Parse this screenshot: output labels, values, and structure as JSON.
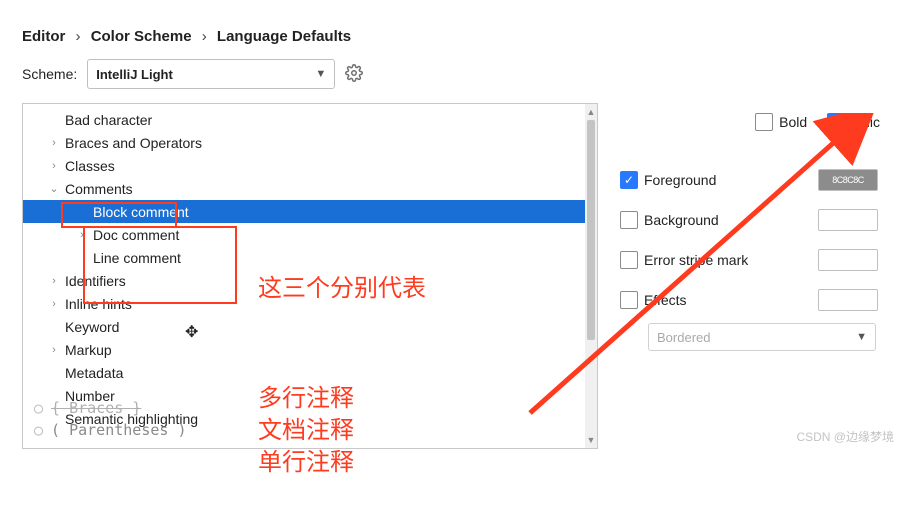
{
  "breadcrumb": [
    "Editor",
    "Color Scheme",
    "Language Defaults"
  ],
  "scheme": {
    "label": "Scheme:",
    "value": "IntelliJ Light"
  },
  "tree": [
    {
      "label": "Bad character",
      "exp": ""
    },
    {
      "label": "Braces and Operators",
      "exp": ">"
    },
    {
      "label": "Classes",
      "exp": ">"
    },
    {
      "label": "Comments",
      "exp": "v"
    },
    {
      "label": "Block comment",
      "exp": "",
      "child": true,
      "sel": true
    },
    {
      "label": "Doc comment",
      "exp": ">",
      "child": true
    },
    {
      "label": "Line comment",
      "exp": "",
      "child": true
    },
    {
      "label": "Identifiers",
      "exp": ">"
    },
    {
      "label": "Inline hints",
      "exp": ">"
    },
    {
      "label": "Keyword",
      "exp": ""
    },
    {
      "label": "Markup",
      "exp": ">"
    },
    {
      "label": "Metadata",
      "exp": ""
    },
    {
      "label": "Number",
      "exp": ""
    },
    {
      "label": "Semantic highlighting",
      "exp": ""
    }
  ],
  "annotations": {
    "main": "这三个分别代表",
    "a1": "多行注释",
    "a2": "文档注释",
    "a3": "单行注释"
  },
  "checks": {
    "bold": "Bold",
    "italic": "Italic"
  },
  "props": {
    "foreground": "Foreground",
    "foreground_val": "8C8C8C",
    "background": "Background",
    "error_stripe": "Error stripe mark",
    "effects": "Effects",
    "effects_type": "Bordered"
  },
  "footer": {
    "l1": "( Braces )",
    "l2": "( Parentheses )"
  },
  "watermark": "CSDN @边缘梦境"
}
